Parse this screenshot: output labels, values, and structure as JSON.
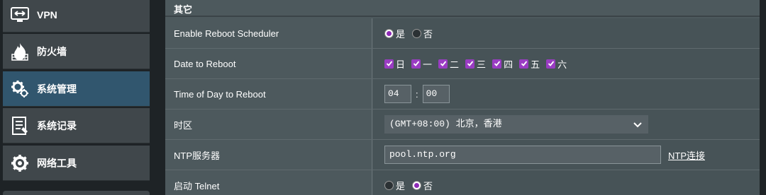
{
  "sidebar": {
    "items": [
      {
        "label": "VPN",
        "icon": "vpn-icon"
      },
      {
        "label": "防火墙",
        "icon": "firewall-icon"
      },
      {
        "label": "系统管理",
        "icon": "gear-icon",
        "active": true
      },
      {
        "label": "系统记录",
        "icon": "log-icon"
      },
      {
        "label": "网络工具",
        "icon": "tools-icon"
      }
    ]
  },
  "panel": {
    "title": "其它",
    "reboot_scheduler": {
      "label": "Enable Reboot Scheduler",
      "yes": "是",
      "no": "否",
      "selected": "yes"
    },
    "date_to_reboot": {
      "label": "Date to Reboot",
      "days": [
        "日",
        "一",
        "二",
        "三",
        "四",
        "五",
        "六"
      ]
    },
    "time_of_day": {
      "label": "Time of Day to Reboot",
      "hour": "04",
      "separator": ":",
      "minute": "00"
    },
    "timezone": {
      "label": "时区",
      "value": "(GMT+08:00) 北京，香港"
    },
    "ntp": {
      "label": "NTP服务器",
      "value": "pool.ntp.org",
      "link": "NTP连接"
    },
    "telnet": {
      "label": "启动 Telnet",
      "yes": "是",
      "no": "否",
      "selected": "no"
    }
  },
  "colors": {
    "accent": "#9a3cc3",
    "active_sidebar": "#31566e",
    "panel_bg": "#4d595d"
  }
}
